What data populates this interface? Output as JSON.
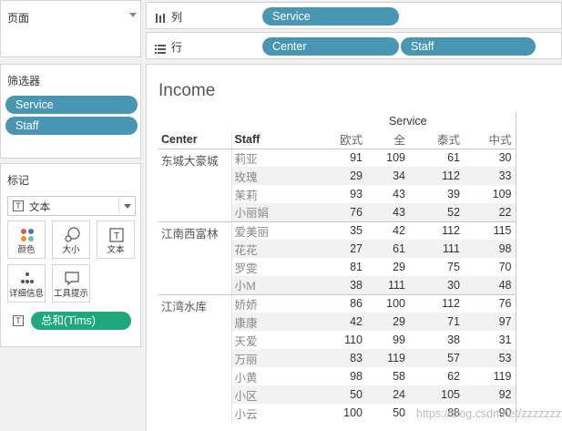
{
  "pages_card": {
    "title": "页面",
    "dropdown_icon": "triangle-down-icon"
  },
  "columns_shelf": {
    "icon": "columns-icon",
    "label": "列",
    "pills": [
      "Service"
    ]
  },
  "rows_shelf": {
    "icon": "rows-icon",
    "label": "行",
    "pills": [
      "Center",
      "Staff"
    ]
  },
  "filters_card": {
    "title": "筛选器",
    "pills": [
      "Service",
      "Staff"
    ]
  },
  "marks_card": {
    "title": "标记",
    "mark_type": "文本",
    "buttons": {
      "color": "颜色",
      "size": "大小",
      "text": "文本",
      "detail": "详细信息",
      "tooltip": "工具提示"
    },
    "field_pill": "总和(Tims)"
  },
  "view": {
    "title": "Income",
    "column_field": "Service",
    "row_headers": [
      "Center",
      "Staff"
    ],
    "columns": [
      "欧式",
      "全",
      "泰式",
      "中式"
    ],
    "groups": [
      {
        "center": "东城大豪城",
        "rows": [
          {
            "staff": "莉亚",
            "values": [
              "91",
              "109",
              "61",
              "30"
            ]
          },
          {
            "staff": "玫瑰",
            "values": [
              "29",
              "34",
              "112",
              "33"
            ]
          },
          {
            "staff": "茉莉",
            "values": [
              "93",
              "43",
              "39",
              "109"
            ]
          },
          {
            "staff": "小丽娟",
            "values": [
              "76",
              "43",
              "52",
              "22"
            ]
          }
        ]
      },
      {
        "center": "江南西富林",
        "rows": [
          {
            "staff": "爱美丽",
            "values": [
              "35",
              "42",
              "112",
              "115"
            ]
          },
          {
            "staff": "花花",
            "values": [
              "27",
              "61",
              "111",
              "98"
            ]
          },
          {
            "staff": "罗雯",
            "values": [
              "81",
              "29",
              "75",
              "70"
            ]
          },
          {
            "staff": "小M",
            "values": [
              "38",
              "111",
              "30",
              "48"
            ]
          }
        ]
      },
      {
        "center": "江湾水库",
        "rows": [
          {
            "staff": "娇娇",
            "values": [
              "86",
              "100",
              "112",
              "76"
            ]
          },
          {
            "staff": "康康",
            "values": [
              "42",
              "29",
              "71",
              "97"
            ]
          },
          {
            "staff": "天爱",
            "values": [
              "110",
              "99",
              "38",
              "31"
            ]
          },
          {
            "staff": "万丽",
            "values": [
              "83",
              "119",
              "57",
              "53"
            ]
          },
          {
            "staff": "小黄",
            "values": [
              "98",
              "58",
              "62",
              "119"
            ]
          },
          {
            "staff": "小区",
            "values": [
              "50",
              "24",
              "105",
              "92"
            ]
          },
          {
            "staff": "小云",
            "values": [
              "100",
              "50",
              "88",
              "90"
            ]
          }
        ]
      }
    ]
  },
  "watermark": "https://blog.csdn.net/zzzzzzzyBC",
  "colors": {
    "pill_blue": "#4996b2",
    "pill_green": "#1fa97a"
  }
}
